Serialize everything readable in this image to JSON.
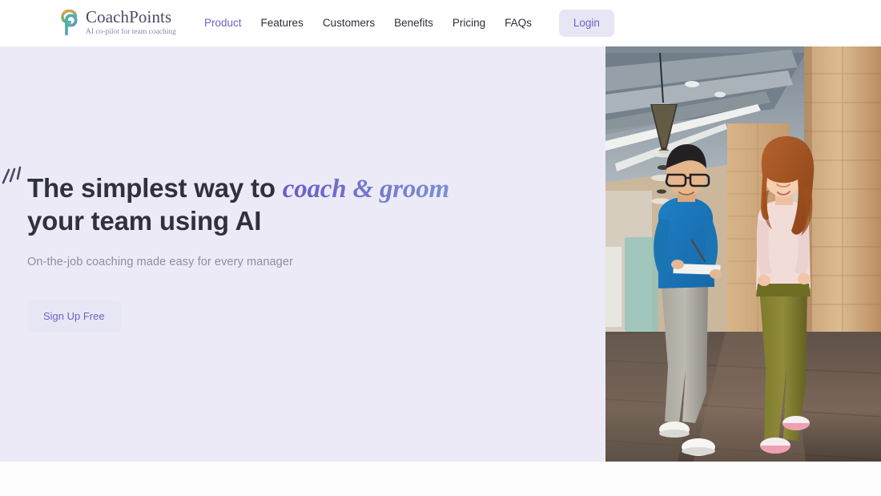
{
  "brand": {
    "name": "CoachPoints",
    "tagline": "AI co-pilot for team coaching",
    "logo_icon": "coachpoints-spiral-p-logo",
    "mark_color_teal": "#3aa894",
    "mark_color_purple": "#6c63c9",
    "name_color": "#4c4a66"
  },
  "nav": {
    "items": [
      {
        "label": "Product",
        "active": true
      },
      {
        "label": "Features",
        "active": false
      },
      {
        "label": "Customers",
        "active": false
      },
      {
        "label": "Benefits",
        "active": false
      },
      {
        "label": "Pricing",
        "active": false
      },
      {
        "label": "FAQs",
        "active": false
      }
    ],
    "login_label": "Login",
    "login_bg": "#e7e6f4",
    "login_color": "#6c63c9"
  },
  "hero": {
    "headline_part1": "The simplest way to ",
    "headline_accent": "coach & groom",
    "headline_part2": " your team using AI",
    "subheadline": "On-the-job coaching made easy for every manager",
    "cta_label": "Sign Up Free",
    "cta_bg": "#e7e6f4",
    "cta_color": "#6c63c9",
    "background_color": "#eceaf7",
    "accent_gradient_from": "#6a5cc6",
    "accent_gradient_to": "#7b8fd3",
    "decoration_icon": "sparkle-lines-icon",
    "photo_alt": "Two colleagues walking and talking in a modern brick-and-steel office corridor; man in a blue sweater holding a tablet beside a woman in a pink top and olive trousers"
  }
}
